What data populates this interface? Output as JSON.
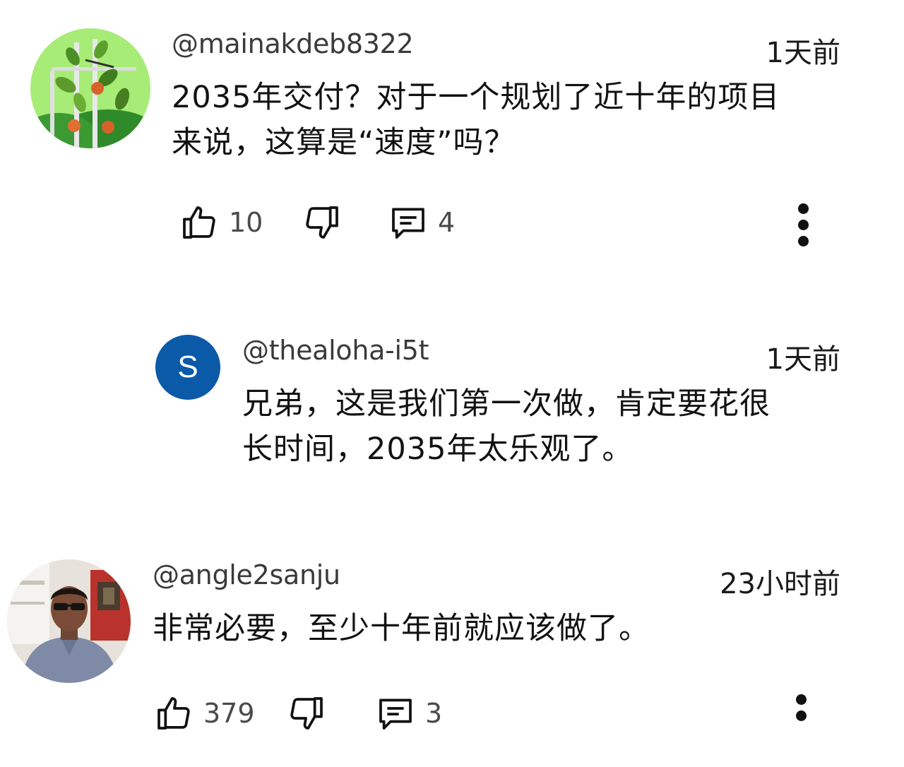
{
  "comments": [
    {
      "author": "@mainakdeb8322",
      "time": "1天前",
      "text_lines": [
        "2035年交付？对于一个规划了近十年的项目",
        "来说，这算是“速度”吗？"
      ],
      "likes": "10",
      "replies": "4",
      "avatar_icon": "garden-plant-avatar"
    },
    {
      "author": "@thealoha-i5t",
      "time": "1天前",
      "text_lines": [
        "兄弟，这是我们第一次做，肯定要花很",
        "长时间，2035年太乐观了。"
      ],
      "avatar_letter": "S",
      "avatar_color": "#0b5aa8"
    },
    {
      "author": "@angle2sanju",
      "time": "23小时前",
      "text_lines": [
        "非常必要，至少十年前就应该做了。"
      ],
      "likes": "379",
      "replies": "3",
      "avatar_icon": "person-photo-avatar"
    }
  ],
  "icons": {
    "like": "thumbs-up-icon",
    "dislike": "thumbs-down-icon",
    "reply": "comment-bubble-icon",
    "more": "more-vertical-icon"
  },
  "colors": {
    "text": "#121212",
    "meta": "#3a3a3a",
    "count": "#4a4a4a"
  }
}
